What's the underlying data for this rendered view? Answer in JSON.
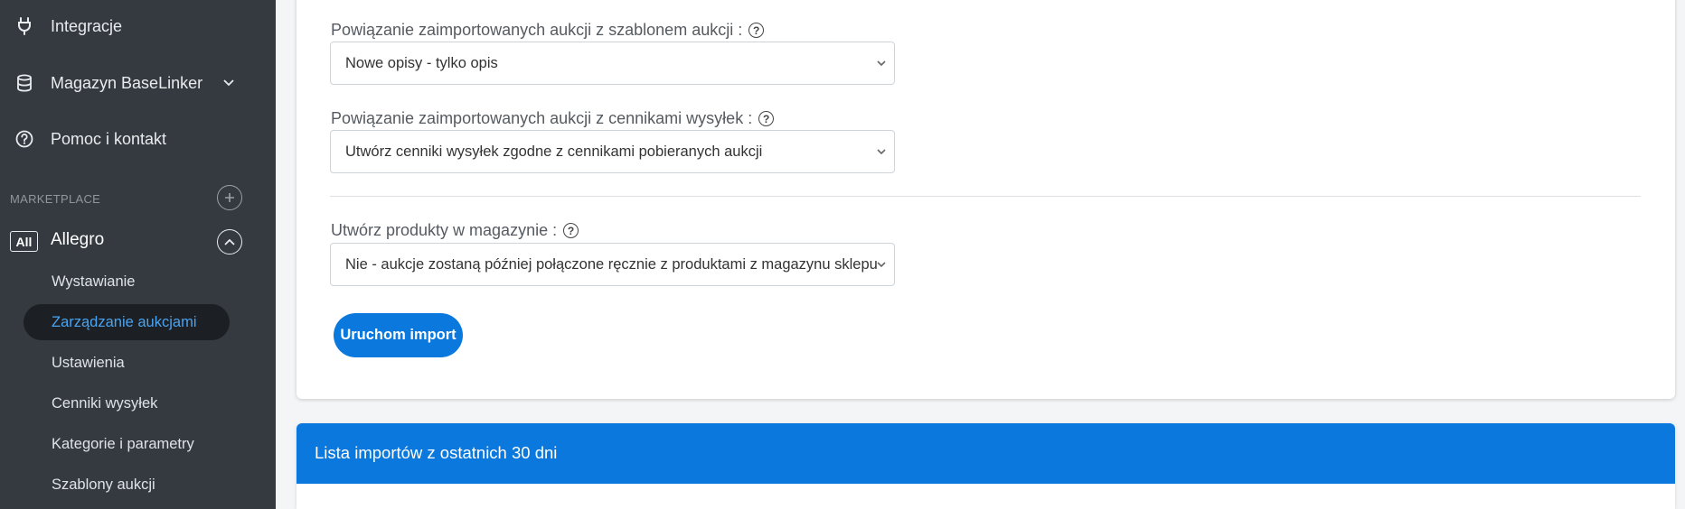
{
  "sidebar": {
    "items": [
      {
        "label": "Integracje",
        "icon": "plug-icon"
      },
      {
        "label": "Magazyn BaseLinker",
        "icon": "database-icon"
      },
      {
        "label": "Pomoc i kontakt",
        "icon": "help-circle-icon"
      }
    ],
    "section_label": "MARKETPLACE",
    "marketplace": {
      "badge": "All",
      "name": "Allegro",
      "subitems": [
        {
          "label": "Wystawianie"
        },
        {
          "label": "Zarządzanie aukcjami",
          "active": true
        },
        {
          "label": "Ustawienia"
        },
        {
          "label": "Cenniki wysyłek"
        },
        {
          "label": "Kategorie i parametry"
        },
        {
          "label": "Szablony aukcji"
        }
      ]
    }
  },
  "form": {
    "fields": [
      {
        "label": "Powiązanie zaimportowanych aukcji z szablonem aukcji :",
        "value": "Nowe opisy - tylko opis"
      },
      {
        "label": "Powiązanie zaimportowanych aukcji z cennikami wysyłek :",
        "value": "Utwórz cenniki wysyłek zgodne z cennikami pobieranych aukcji"
      },
      {
        "label": "Utwórz produkty w magazynie :",
        "value": "Nie - aukcje zostaną później połączone ręcznie z produktami z magazynu sklepu"
      }
    ],
    "submit_label": "Uruchom import"
  },
  "imports_panel": {
    "title": "Lista importów z ostatnich 30 dni"
  },
  "colors": {
    "sidebar_bg": "#343a40",
    "accent": "#0a78dc",
    "active_text": "#4aa3f0"
  }
}
